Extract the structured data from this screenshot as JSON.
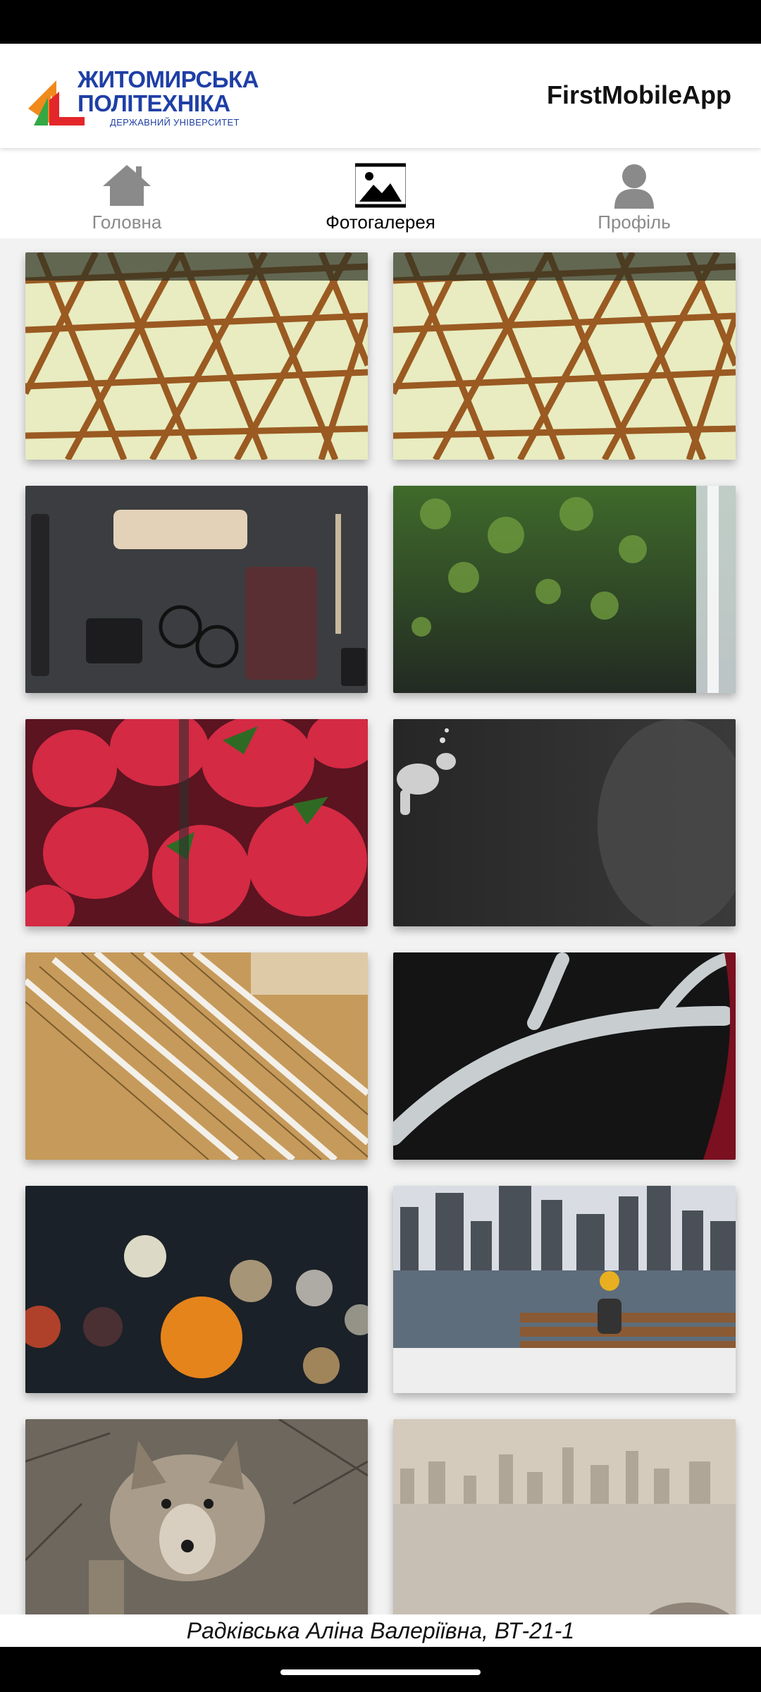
{
  "header": {
    "logo": {
      "line1": "ЖИТОМИРСЬКА",
      "line2": "ПОЛІТЕХНІКА",
      "line3": "ДЕРЖАВНИЙ УНІВЕРСИТЕТ"
    },
    "title": "FirstMobileApp"
  },
  "tabs": [
    {
      "label": "Головна",
      "icon": "home-icon",
      "active": false
    },
    {
      "label": "Фотогалерея",
      "icon": "image-icon",
      "active": true
    },
    {
      "label": "Профіль",
      "icon": "person-icon",
      "active": false
    }
  ],
  "gallery": {
    "photos": [
      {
        "subject": "steel-dome-lattice"
      },
      {
        "subject": "steel-dome-lattice"
      },
      {
        "subject": "desk-items-flatlay"
      },
      {
        "subject": "mossy-cliff-waterfall"
      },
      {
        "subject": "strawberries"
      },
      {
        "subject": "scuba-diver"
      },
      {
        "subject": "rulers-and-pens"
      },
      {
        "subject": "antler-on-black"
      },
      {
        "subject": "city-bokeh-lights"
      },
      {
        "subject": "person-on-bench-skyline"
      },
      {
        "subject": "coyote"
      },
      {
        "subject": "hazy-city-water"
      }
    ]
  },
  "footer": {
    "text": "Радківська Аліна Валеріївна, ВТ-21-1"
  },
  "colors": {
    "logo_blue": "#1f3fa6",
    "logo_red": "#e3262a",
    "logo_green": "#33a844",
    "logo_orange": "#f08a1c",
    "active_tab": "#000000",
    "inactive_tab": "#8a8a8a"
  }
}
